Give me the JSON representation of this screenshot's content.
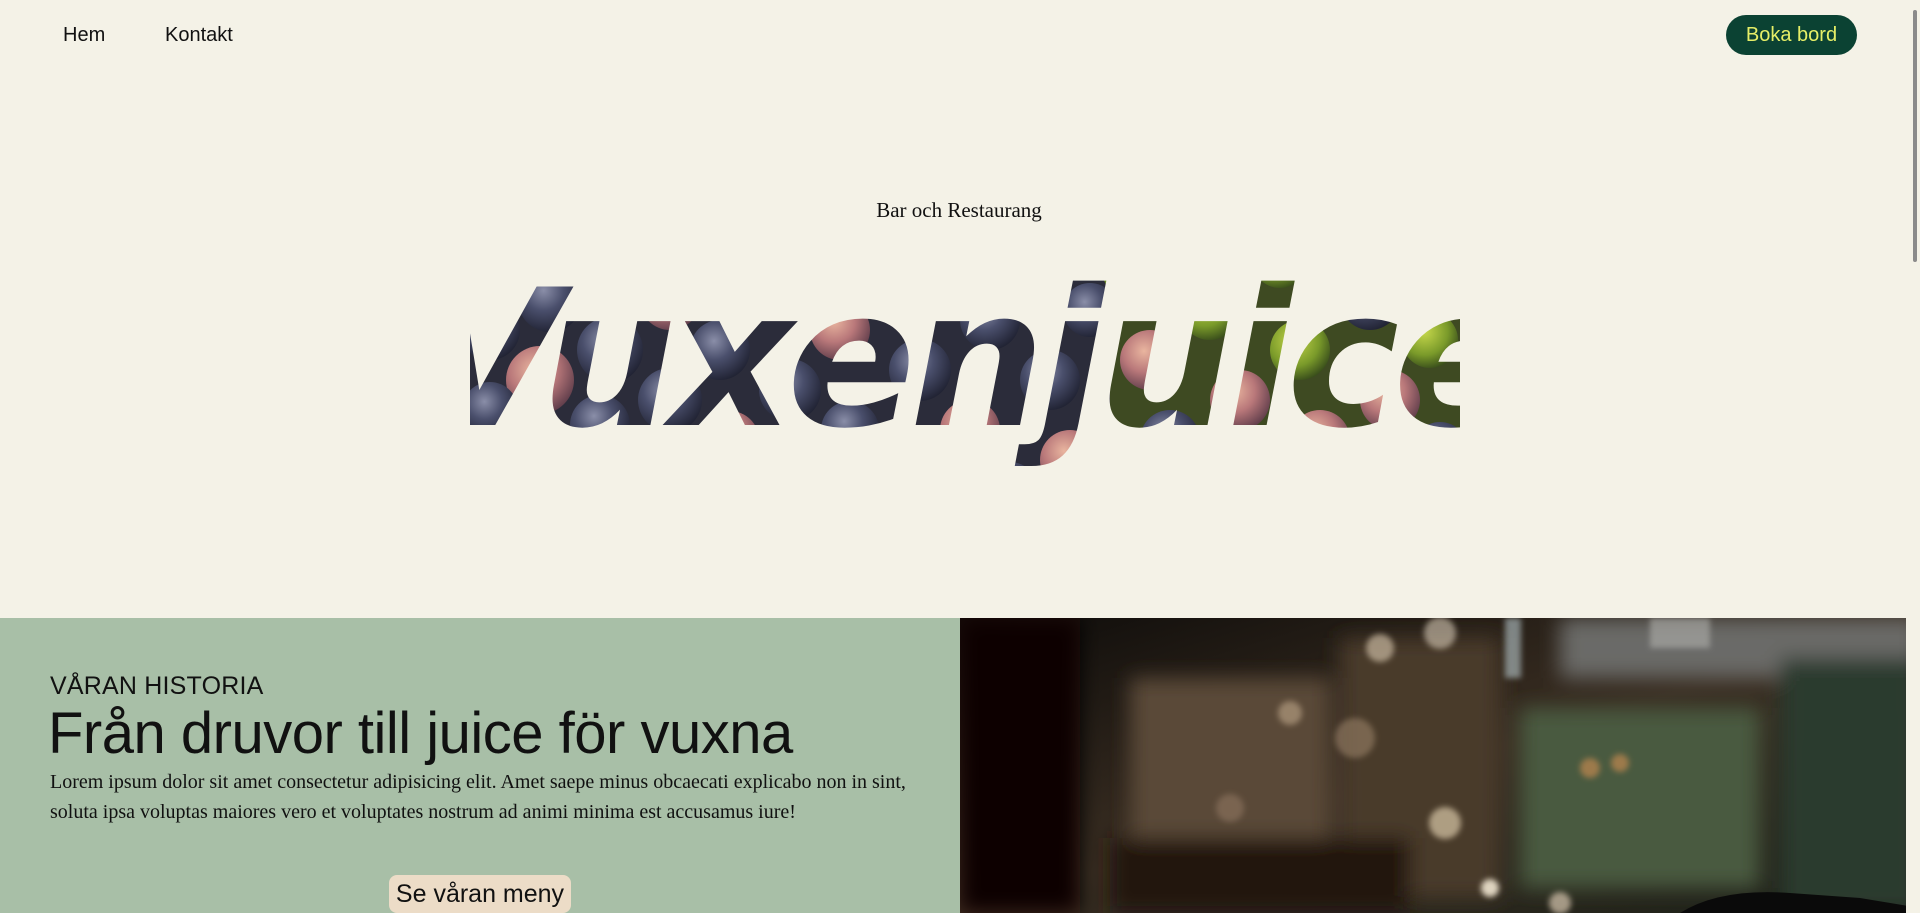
{
  "nav": {
    "home_label": "Hem",
    "contact_label": "Kontakt",
    "book_label": "Boka bord"
  },
  "hero": {
    "subtitle": "Bar och Restaurang",
    "brand": "Vuxenjuice"
  },
  "story": {
    "eyebrow": "VÅRAN HISTORIA",
    "heading": "Från druvor till juice för vuxna",
    "body": "Lorem ipsum dolor sit amet consectetur adipisicing elit. Amet saepe minus obcaecati explicabo non in sint, soluta ipsa voluptas maiores vero et voluptates nostrum ad animi minima est accusamus iure!",
    "menu_button": "Se våran meny"
  },
  "colors": {
    "background": "#f4f2e7",
    "accent_dark_green": "#0b4233",
    "accent_lime_text": "#e5ee67",
    "story_green": "#a8bfa7",
    "menu_button_bg": "#ecdcc7"
  },
  "photo": {
    "description_icon": "bar-bokeh-photo"
  }
}
